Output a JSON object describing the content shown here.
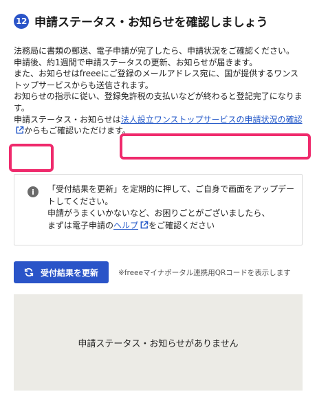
{
  "step": {
    "number": "12",
    "title": "申請ステータス・お知らせを確認しましょう"
  },
  "description": {
    "line1": "法務局に書類の郵送、電子申請が完了したら、申請状況をご確認ください。",
    "line2": "申請後、約1週間で申請ステータスの更新、お知らせが届きます。",
    "line3": "また、お知らせはfreeeにご登録のメールアドレス宛に、国が提供するワンストップサービスからも送信されます。",
    "line4": "お知らせの指示に従い、登録免許税の支払いなどが終わると登記完了になります。",
    "line5_prefix": "申請ステータス・お知らせは",
    "link_part1": "法人設立ワンストップサービスの申請状況の",
    "link_part2": "確認",
    "line5_suffix": "からもご確認いただけます。"
  },
  "info": {
    "icon": "info-icon",
    "line1": "「受付結果を更新」を定期的に押して、ご自身で画面をアップデートしてください。",
    "line2": "申請がうまくいかないなど、お困りごとがございましたら、",
    "line3_prefix": "まずは電子申請の",
    "help_link": "ヘルプ",
    "line3_suffix": "をご確認ください"
  },
  "actions": {
    "update_label": "受付結果を更新",
    "update_icon": "refresh-icon",
    "note": "※freeeマイナポータル連携用QRコードを表示します"
  },
  "status_panel": {
    "empty_message": "申請ステータス・お知らせがありません"
  },
  "colors": {
    "accent": "#2a54c8",
    "link": "#2358c8",
    "highlight": "#ef2a6c",
    "panel_bg": "#ecebe6"
  }
}
